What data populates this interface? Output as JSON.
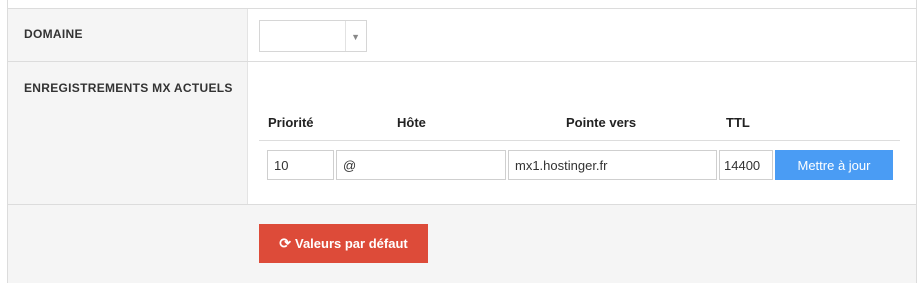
{
  "domain_row": {
    "label": "DOMAINE",
    "select_value": "",
    "arrow_icon": "triangle-down-icon"
  },
  "mx_section": {
    "label": "ENREGISTREMENTS MX ACTUELS",
    "columns": [
      "Priorité",
      "Hôte",
      "Pointe vers",
      "TTL"
    ],
    "record": {
      "priority": "10",
      "host": "@",
      "points_to": "mx1.hostinger.fr",
      "ttl": "14400"
    },
    "update_button": "Mettre à jour"
  },
  "footer": {
    "reset_button": "Valeurs par défaut",
    "reset_icon": "refresh-icon",
    "colors": {
      "reset_button": "#dd4b39",
      "update_button": "#4a9cf4"
    }
  }
}
